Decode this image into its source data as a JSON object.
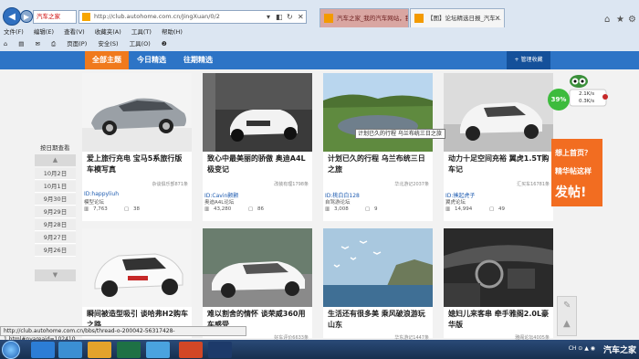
{
  "browser": {
    "addr_tab_text": "汽车之家",
    "url": "http://club.autohome.com.cn/JingXuan/0/2",
    "tabs": [
      {
        "label": "汽车之家_我的汽车网站，我的..."
      },
      {
        "label": "【图】论坛精选日报_汽车..."
      }
    ],
    "menu": [
      "文件(F)",
      "编辑(E)",
      "查看(V)",
      "收藏夹(A)",
      "工具(T)",
      "帮助(H)"
    ],
    "toolbar": [
      "页面(P)",
      "安全(S)",
      "工具(O)",
      "❷"
    ]
  },
  "topnav": {
    "items": [
      "全部主题",
      "今日精选",
      "往期精选"
    ],
    "manage": "+ 管理收藏"
  },
  "dates": {
    "title": "按日期查看",
    "items": [
      "10月2日",
      "10月1日",
      "9月30日",
      "9月29日",
      "9月28日",
      "9月27日",
      "9月26日"
    ]
  },
  "cards": [
    {
      "title": "爱上旅行充电 宝马5系旅行版车模写真",
      "meta": "杂谈俱乐部871条",
      "id": "ID:happyliuh",
      "forum": "模型论坛",
      "views": "7,763",
      "replies": "38"
    },
    {
      "title": "致心中最美丽的骄傲 奥迪A4L极变记",
      "meta": "改装有理1798条",
      "id": "ID:Cavin颢颢",
      "forum": "奥迪A4L论坛",
      "views": "43,280",
      "replies": "86"
    },
    {
      "title": "计划已久的行程 乌兰布统三日之旅",
      "meta": "华北游记2037条",
      "id": "ID:桃白白128",
      "forum": "自驾游论坛",
      "views": "3,008",
      "replies": "9"
    },
    {
      "title": "动力十足空间充裕 翼虎1.5T购车记",
      "meta": "汇买车16781条",
      "id": "ID:揍起虎子",
      "forum": "翼虎论坛",
      "views": "14,994",
      "replies": "49"
    },
    {
      "title": "瞬间被造型吸引 谈哈弗H2购车之路",
      "meta": "",
      "id": "",
      "forum": "",
      "views": "",
      "replies": ""
    },
    {
      "title": "难以割舍的情怀 谈荣威360用车感受",
      "meta": "好车评价6633条",
      "id": "",
      "forum": "",
      "views": "",
      "replies": ""
    },
    {
      "title": "生活还有很多美 乘风破浪游玩山东",
      "meta": "华东游记1447条",
      "id": "",
      "forum": "",
      "views": "",
      "replies": ""
    },
    {
      "title": "媳妇儿来客串 牵手雅阁2.0L豪华版",
      "meta": "雅阁论坛4005条",
      "id": "",
      "forum": "",
      "views": "",
      "replies": ""
    }
  ],
  "tooltip": "计划已久的行程 乌兰布统三日之旅",
  "widget": {
    "percent": "39%",
    "up": "2.1K/s",
    "down": "0.3K/s"
  },
  "ad": {
    "line1": "想上首页？",
    "line2": "精华帖这样",
    "line3": "发帖!"
  },
  "status_url": "http://club.autohome.com.cn/bbs/thread-o-200042-56317428-1.html#pvareaid=102410",
  "tray_text": "CH ⊙ ▲ ◉",
  "watermark": "汽车之家"
}
